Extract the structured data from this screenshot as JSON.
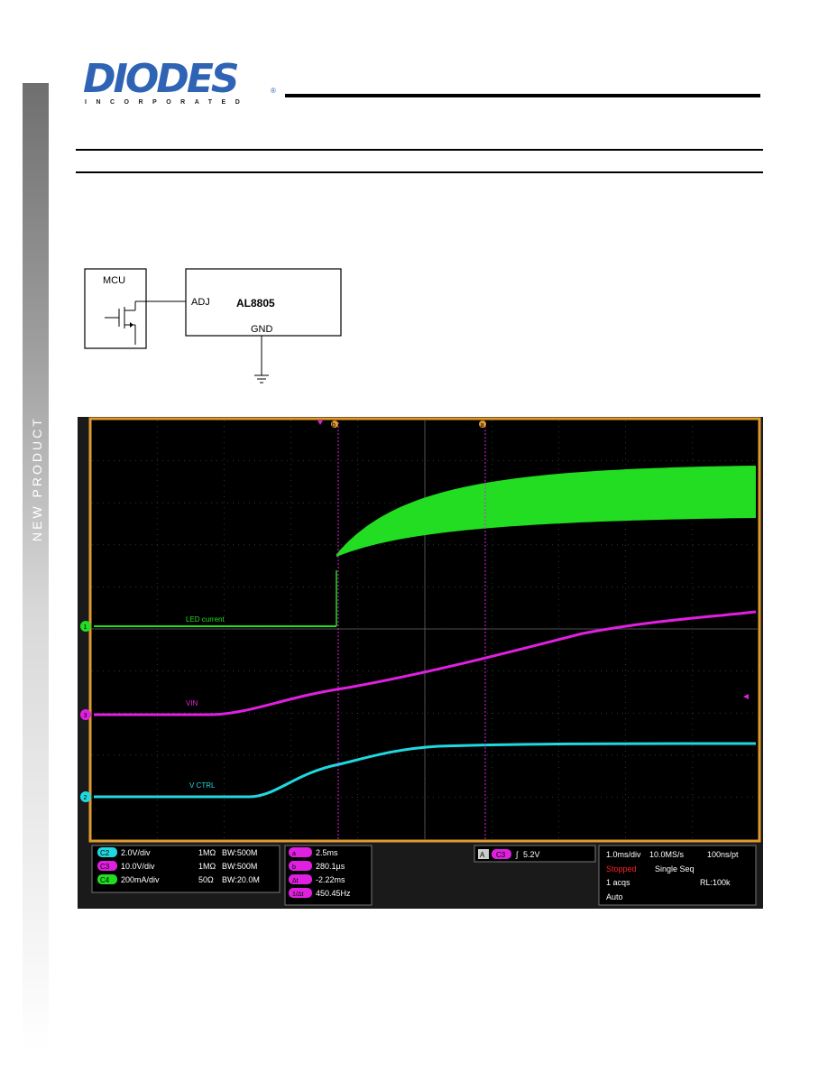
{
  "sidebar": {
    "label": "NEW PRODUCT"
  },
  "logo": {
    "name": "DIODES",
    "subtitle": "INCORPORATED",
    "reg": "®"
  },
  "diagram": {
    "mcu": "MCU",
    "adj": "ADJ",
    "part": "AL8805",
    "gnd": "GND"
  },
  "colors": {
    "ch_led": "#22dd22",
    "ch_vin": "#e020e0",
    "ch_ctrl": "#20d8e0",
    "frame": "#e09a30"
  },
  "scope": {
    "traces": {
      "led": "LED current",
      "vin": "VIN",
      "ctrl": "V CTRL"
    },
    "markers": {
      "ch1": "1",
      "ch2": "2",
      "ch3": "3",
      "cursor_a": "a",
      "cursor_b": "b"
    },
    "channels": [
      {
        "tag": "C2",
        "scale": "2.0V/div",
        "imp": "1MΩ",
        "bw": "BW:500M"
      },
      {
        "tag": "C3",
        "scale": "10.0V/div",
        "imp": "1MΩ",
        "bw": "BW:500M"
      },
      {
        "tag": "C4",
        "scale": "200mA/div",
        "imp": "50Ω",
        "bw": "BW:20.0M"
      }
    ],
    "cursors": [
      {
        "tag": "a",
        "value": "2.5ms"
      },
      {
        "tag": "b",
        "value": "280.1µs"
      },
      {
        "tag": "Δt",
        "value": "-2.22ms"
      },
      {
        "tag": "1/Δt",
        "value": "450.45Hz"
      }
    ],
    "trigger": {
      "tag": "A",
      "src": "C3",
      "level": "5.2V"
    },
    "timebase": {
      "hdiv": "1.0ms/div",
      "rate": "10.0MS/s",
      "pt": "100ns/pt",
      "state": "Stopped",
      "mode": "Single Seq",
      "acqs": "1 acqs",
      "rl": "RL:100k",
      "auto": "Auto"
    }
  }
}
